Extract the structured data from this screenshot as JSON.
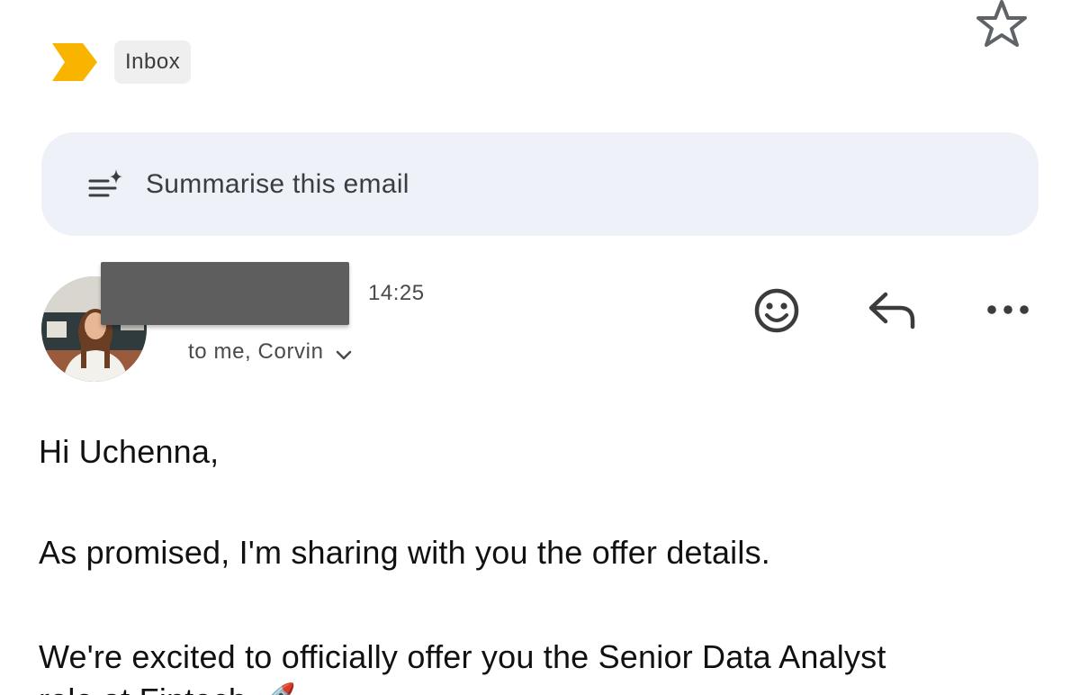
{
  "email": {
    "label": "Inbox",
    "summarise_label": "Summarise this email",
    "time": "14:25",
    "recipients": "to me, Corvin",
    "body": [
      "Hi Uchenna,",
      "As promised, I'm sharing with you the offer details.",
      "We're excited to officially offer you the Senior Data Analyst",
      "role at Fintech 🚀"
    ]
  },
  "icons": {
    "star": "star-outline-icon",
    "importance": "important-marker-icon",
    "summarise": "summarise-sparkle-icon",
    "emoji": "add-reaction-icon",
    "reply": "reply-icon",
    "more": "more-horizontal-icon",
    "expand": "chevron-down-icon"
  },
  "colors": {
    "importance_marker": "#f9b400",
    "summary_background": "#eef2f8",
    "chip_background": "#efefef",
    "redaction": "#5e5e5e"
  }
}
